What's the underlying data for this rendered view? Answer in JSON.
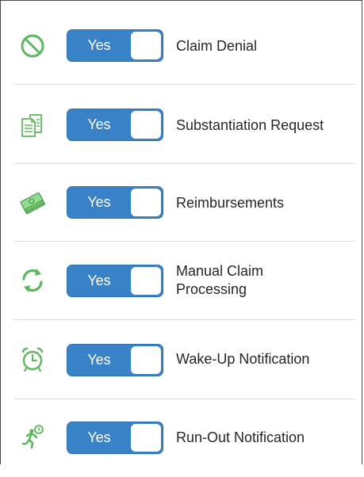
{
  "notifications": [
    {
      "label": "Claim Denial",
      "toggle": "Yes",
      "enabled": true,
      "icon": "prohibited-icon"
    },
    {
      "label": "Substantiation Request",
      "toggle": "Yes",
      "enabled": true,
      "icon": "documents-icon"
    },
    {
      "label": "Reimbursements",
      "toggle": "Yes",
      "enabled": true,
      "icon": "money-stack-icon"
    },
    {
      "label": "Manual Claim Processing",
      "toggle": "Yes",
      "enabled": true,
      "icon": "refresh-icon"
    },
    {
      "label": "Wake-Up Notification",
      "toggle": "Yes",
      "enabled": true,
      "icon": "alarm-clock-icon"
    },
    {
      "label": "Run-Out Notification",
      "toggle": "Yes",
      "enabled": true,
      "icon": "running-person-clock-icon"
    }
  ],
  "colors": {
    "toggle_on": "#3a82c8",
    "icon_green": "#5cb85c",
    "text": "#262626"
  }
}
